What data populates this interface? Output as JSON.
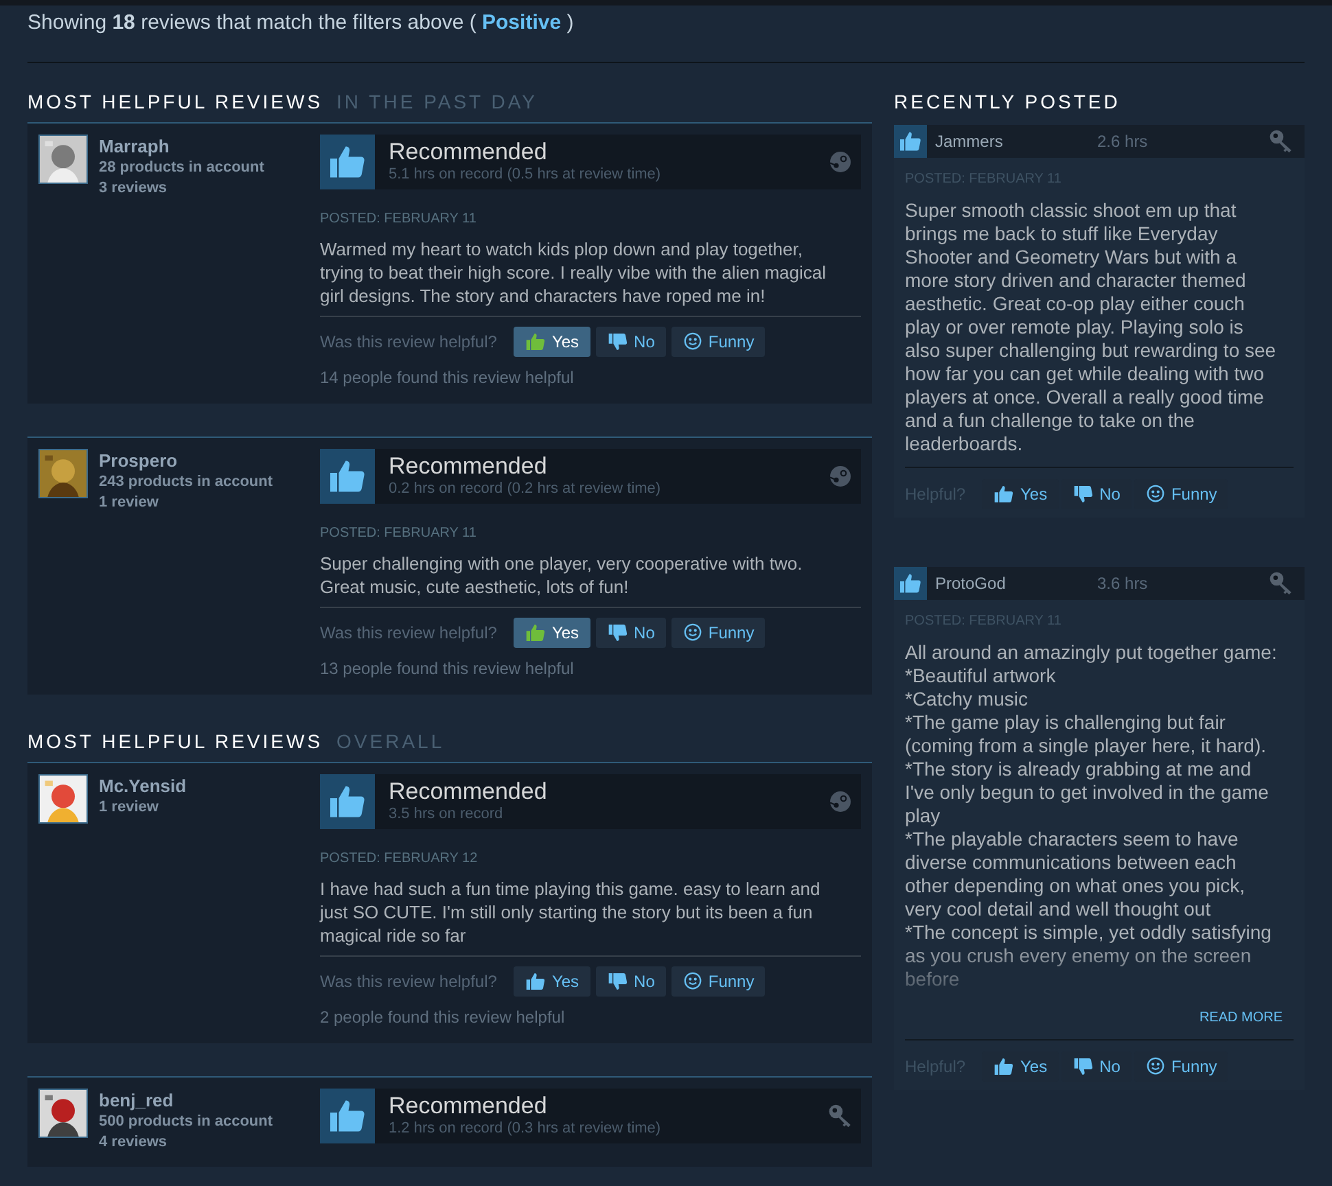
{
  "summary": {
    "prefix": "Showing ",
    "count": "18",
    "middle": " reviews that match the filters above ( ",
    "filter": "Positive",
    "suffix": " )"
  },
  "sections": [
    {
      "title": "MOST HELPFUL REVIEWS",
      "subtitle": "IN THE PAST DAY",
      "reviews": [
        {
          "author": "Marraph",
          "products": "28 products in account",
          "review_count": "3 reviews",
          "verdict": "Recommended",
          "hours": "5.1 hrs on record (0.5 hrs at review time)",
          "kind": "steam",
          "posted": "POSTED: FEBRUARY 11",
          "body": "Warmed my heart to watch kids plop down and play together, trying to beat their high score. I really vibe with the alien magical girl designs. The story and characters have roped me in!",
          "prompt": "Was this review helpful?",
          "votes": [
            {
              "kind": "yes",
              "label": "Yes",
              "selected": true
            },
            {
              "kind": "no",
              "label": "No",
              "selected": false
            },
            {
              "kind": "funny",
              "label": "Funny",
              "selected": false
            }
          ],
          "helpful_count": "14 people found this review helpful"
        },
        {
          "author": "Prospero",
          "products": "243 products in account",
          "review_count": "1 review",
          "verdict": "Recommended",
          "hours": "0.2 hrs on record (0.2 hrs at review time)",
          "kind": "steam",
          "posted": "POSTED: FEBRUARY 11",
          "body": "Super challenging with one player, very cooperative with two. Great music, cute aesthetic, lots of fun!",
          "prompt": "Was this review helpful?",
          "votes": [
            {
              "kind": "yes",
              "label": "Yes",
              "selected": true
            },
            {
              "kind": "no",
              "label": "No",
              "selected": false
            },
            {
              "kind": "funny",
              "label": "Funny",
              "selected": false
            }
          ],
          "helpful_count": "13 people found this review helpful"
        }
      ]
    },
    {
      "title": "MOST HELPFUL REVIEWS",
      "subtitle": "OVERALL",
      "reviews": [
        {
          "author": "Mc.Yensid",
          "review_count": "1 review",
          "verdict": "Recommended",
          "hours": "3.5 hrs on record",
          "kind": "steam",
          "posted": "POSTED: FEBRUARY 12",
          "body": "I have had such a fun time playing this game. easy to learn and just SO CUTE. I'm still only starting the story but its been a fun magical ride so far",
          "prompt": "Was this review helpful?",
          "votes": [
            {
              "kind": "yes",
              "label": "Yes",
              "selected": false
            },
            {
              "kind": "no",
              "label": "No",
              "selected": false
            },
            {
              "kind": "funny",
              "label": "Funny",
              "selected": false
            }
          ],
          "helpful_count": "2 people found this review helpful"
        },
        {
          "author": "benj_red",
          "products": "500 products in account",
          "review_count": "4 reviews",
          "verdict": "Recommended",
          "hours": "1.2 hrs on record (0.3 hrs at review time)",
          "kind": "key"
        }
      ]
    }
  ],
  "recent": {
    "title": "RECENTLY POSTED",
    "reviews": [
      {
        "author": "Jammers",
        "hours": "2.6 hrs",
        "kind": "key",
        "posted": "POSTED: FEBRUARY 11",
        "body": "Super smooth classic shoot em up that brings me back to stuff like Everyday Shooter and Geometry Wars but with a more story driven and character themed aesthetic. Great co-op play either couch play or over remote play. Playing solo is also super challenging but rewarding to see how far you can get while dealing with two players at once. Overall a really good time and a fun challenge to take on the leaderboards.",
        "truncated": false,
        "prompt": "Helpful?",
        "votes": [
          {
            "kind": "yes",
            "label": "Yes"
          },
          {
            "kind": "no",
            "label": "No"
          },
          {
            "kind": "funny",
            "label": "Funny"
          }
        ]
      },
      {
        "author": "ProtoGod",
        "hours": "3.6 hrs",
        "kind": "key",
        "posted": "POSTED: FEBRUARY 11",
        "body": "All around an amazingly put together game:\n*Beautiful artwork\n*Catchy music\n*The game play is challenging but fair (coming from a single player here, it hard).\n*The story is already grabbing at me and I've only begun to get involved in the game play\n*The playable characters seem to have diverse communications between each other depending on what ones you pick, very cool detail and well thought out\n*The concept is simple, yet oddly satisfying as you crush every enemy on the screen before",
        "truncated": true,
        "read_more": "READ MORE",
        "prompt": "Helpful?",
        "votes": [
          {
            "kind": "yes",
            "label": "Yes"
          },
          {
            "kind": "no",
            "label": "No"
          },
          {
            "kind": "funny",
            "label": "Funny"
          }
        ]
      }
    ]
  }
}
